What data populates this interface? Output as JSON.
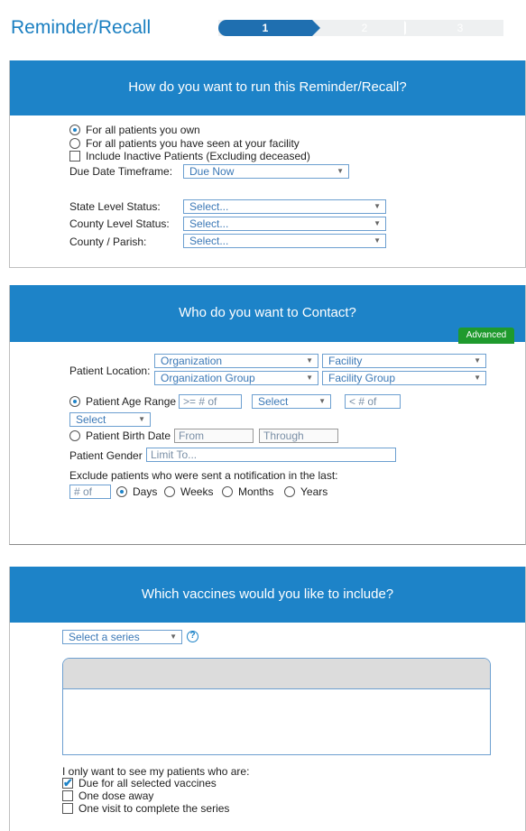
{
  "header": {
    "title": "Reminder/Recall",
    "steps": [
      "1",
      "2",
      "3"
    ]
  },
  "panel1": {
    "heading": "How do you want to run this Reminder/Recall?",
    "options": [
      "For all patients you own",
      "For all patients you have seen at your facility"
    ],
    "include_inactive": "Include Inactive Patients (Excluding deceased)",
    "due_label": "Due Date Timeframe:",
    "due_value": "Due Now",
    "state_label": "State Level Status:",
    "county_label": "County Level Status:",
    "parish_label": "County / Parish:",
    "select_placeholder": "Select..."
  },
  "panel2": {
    "heading": "Who do you want to Contact?",
    "location_label": "Patient Location:",
    "organization": "Organization",
    "facility": "Facility",
    "organization_group": "Organization Group",
    "facility_group": "Facility Group",
    "age_range_label": "Patient Age Range",
    "age_min_placeholder": ">= # of",
    "age_unit": "Select",
    "age_max_placeholder": "< # of",
    "age_unit2": "Select",
    "birth_date_label": "Patient Birth Date",
    "from_placeholder": "From",
    "through_placeholder": "Through",
    "gender_label": "Patient Gender",
    "gender_placeholder": "Limit To...",
    "exclude_label": "Exclude patients who were sent a notification in the last:",
    "count_placeholder": "# of",
    "periods": [
      "Days",
      "Weeks",
      "Months",
      "Years"
    ],
    "advanced": "Advanced"
  },
  "panel3": {
    "heading": "Which vaccines would you like to include?",
    "series_placeholder": "Select a series",
    "help": "?",
    "only_label": "I only want to see my patients who are:",
    "checks": [
      "Due for all selected vaccines",
      "One dose away",
      "One visit to complete the series"
    ]
  },
  "colors": {
    "accent": "#1d83c8",
    "advanced": "#1f9a2d"
  }
}
